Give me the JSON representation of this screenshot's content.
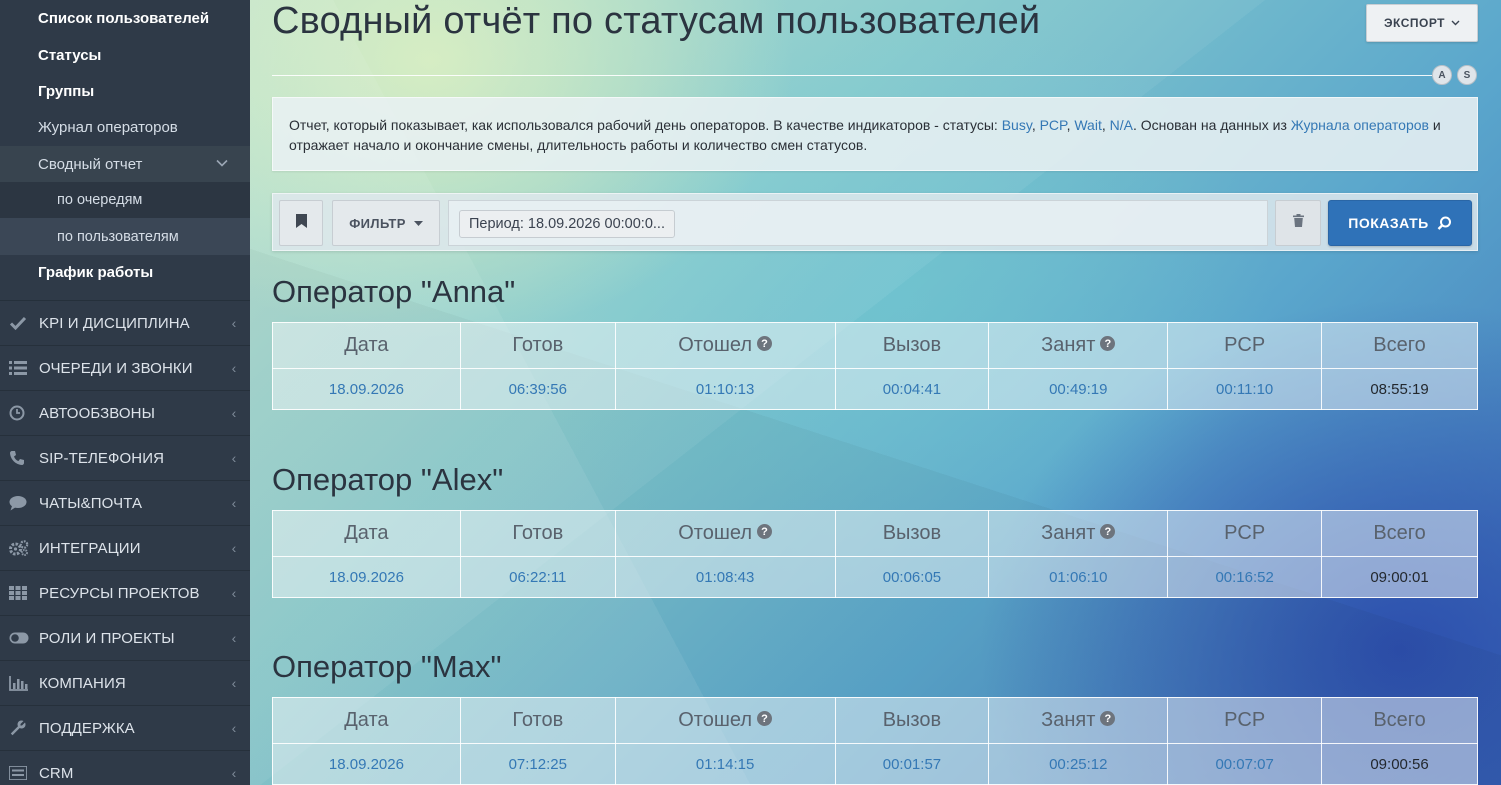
{
  "sidebar": {
    "sub_items": [
      {
        "label": "Список пользователей"
      },
      {
        "label": "Статусы"
      },
      {
        "label": "Группы"
      },
      {
        "label": "Журнал операторов"
      },
      {
        "label": "Сводный отчет"
      },
      {
        "label": "по очередям"
      },
      {
        "label": "по пользователям"
      },
      {
        "label": "График работы"
      }
    ],
    "nav_items": [
      {
        "label": "KPI И ДИСЦИПЛИНА",
        "icon": "check-icon"
      },
      {
        "label": "ОЧЕРЕДИ И ЗВОНКИ",
        "icon": "list-icon"
      },
      {
        "label": "АВТООБЗВОНЫ",
        "icon": "clock-icon"
      },
      {
        "label": "SIP-ТЕЛЕФОНИЯ",
        "icon": "phone-icon"
      },
      {
        "label": "ЧАТЫ&ПОЧТА",
        "icon": "chat-icon"
      },
      {
        "label": "ИНТЕГРАЦИИ",
        "icon": "gears-icon"
      },
      {
        "label": "РЕСУРСЫ ПРОЕКТОВ",
        "icon": "grid-icon"
      },
      {
        "label": "РОЛИ И ПРОЕКТЫ",
        "icon": "toggle-icon"
      },
      {
        "label": "КОМПАНИЯ",
        "icon": "bar-chart-icon"
      },
      {
        "label": "ПОДДЕРЖКА",
        "icon": "wrench-icon"
      },
      {
        "label": "CRM",
        "icon": "list-icon"
      }
    ]
  },
  "header": {
    "title": "Сводный отчёт по статусам пользователей",
    "export_label": "ЭКСПОРТ",
    "badge_a": "A",
    "badge_s": "S"
  },
  "description": {
    "part1": "Отчет, который показывает, как использовался рабочий день операторов. В качестве индикаторов - статусы: ",
    "link_busy": "Busy",
    "sep1": ", ",
    "link_pcp": "PCP",
    "sep2": ", ",
    "link_wait": "Wait",
    "sep3": ", ",
    "link_na": "N/A",
    "part2": ". Основан на данных из ",
    "link_journal": "Журнала операторов",
    "part3": " и отражает начало и окончание смены, длительность работы и количество смен статусов."
  },
  "filter": {
    "label": "ФИЛЬТР",
    "chip": "Период: 18.09.2026 00:00:0...",
    "show_label": "ПОКАЗАТЬ"
  },
  "columns": [
    "Дата",
    "Готов",
    "Отошел",
    "Вызов",
    "Занят",
    "PCP",
    "Всего"
  ],
  "help_mark": "?",
  "operators": [
    {
      "title": "Оператор \"Anna\"",
      "row": [
        "18.09.2026",
        "06:39:56",
        "01:10:13",
        "00:04:41",
        "00:49:19",
        "00:11:10",
        "08:55:19"
      ]
    },
    {
      "title": "Оператор \"Alex\"",
      "row": [
        "18.09.2026",
        "06:22:11",
        "01:08:43",
        "00:06:05",
        "01:06:10",
        "00:16:52",
        "09:00:01"
      ]
    },
    {
      "title": "Оператор \"Max\"",
      "row": [
        "18.09.2026",
        "07:12:25",
        "01:14:15",
        "00:01:57",
        "00:25:12",
        "00:07:07",
        "09:00:56"
      ]
    }
  ]
}
